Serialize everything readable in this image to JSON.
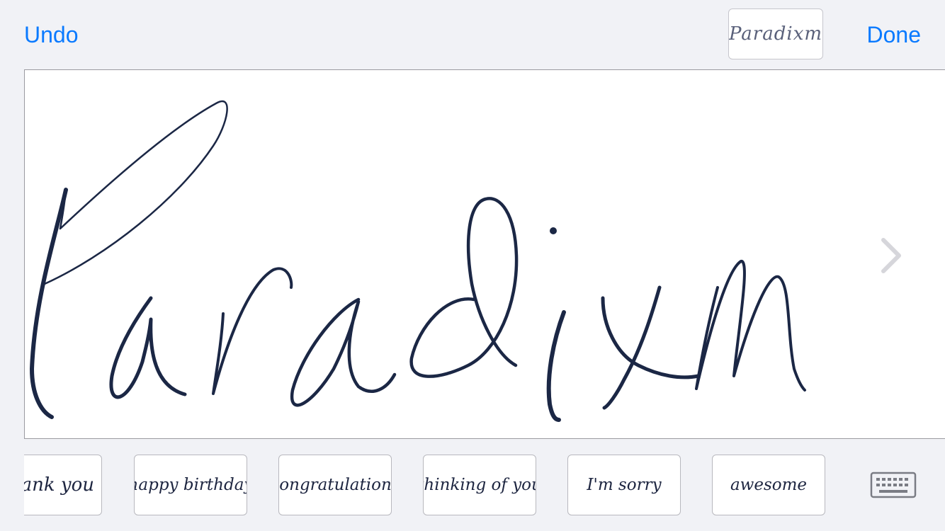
{
  "toolbar": {
    "undo_label": "Undo",
    "done_label": "Done",
    "preview_text": "Paradixm"
  },
  "canvas": {
    "handwriting_text": "Paradixm",
    "ink_color": "#1b2745",
    "next_icon": "chevron-right-icon"
  },
  "suggestions": [
    {
      "label": "thank you",
      "visible_text": "ank you"
    },
    {
      "label": "happy birthday"
    },
    {
      "label": "congratulations"
    },
    {
      "label": "thinking of you"
    },
    {
      "label": "I'm sorry",
      "visible_text": "I'm sorry"
    },
    {
      "label": "awesome"
    }
  ],
  "keyboard": {
    "icon": "keyboard-icon"
  },
  "colors": {
    "accent": "#0a7aff",
    "background": "#f1f2f6",
    "ink": "#1b2745",
    "chevron": "#d6d6db"
  }
}
